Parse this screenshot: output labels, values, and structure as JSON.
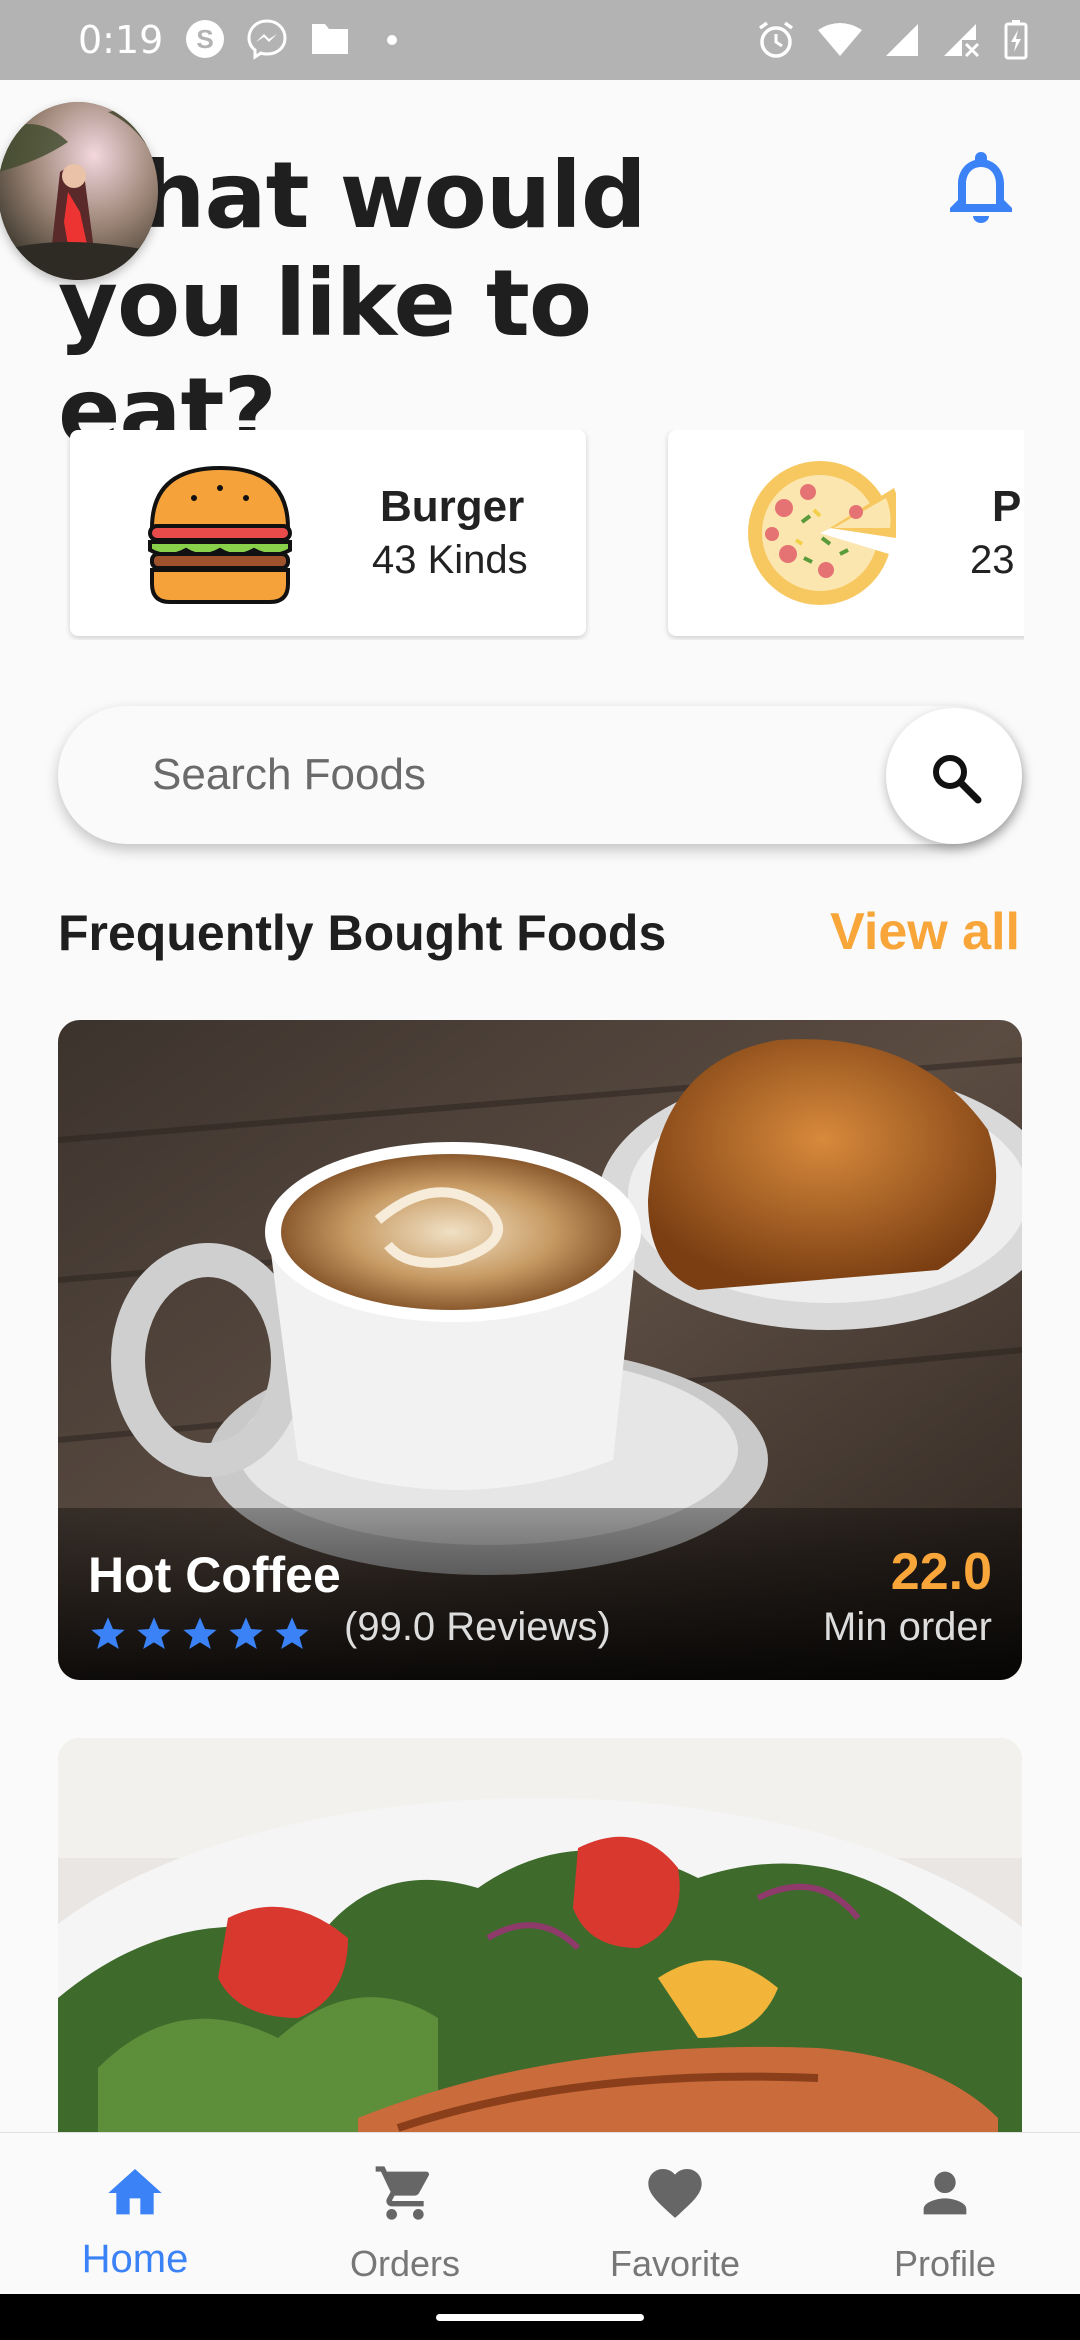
{
  "status_bar": {
    "time": "0:19",
    "left_icons": [
      "skype-icon",
      "messenger-icon",
      "folder-icon",
      "dot-icon"
    ],
    "right_icons": [
      "alarm-icon",
      "wifi-icon",
      "signal-icon",
      "signal-noservice-icon",
      "battery-charging-icon"
    ]
  },
  "header": {
    "title_line1": "hat would",
    "title_line2": "you like to eat?",
    "avatar_icon": "profile-avatar",
    "bell_icon": "bell-icon"
  },
  "categories": [
    {
      "name": "Burger",
      "count": "43 Kinds",
      "icon": "burger-icon"
    },
    {
      "name": "P",
      "count": "23",
      "icon": "pizza-icon"
    }
  ],
  "search": {
    "placeholder": "Search Foods",
    "icon": "search-icon"
  },
  "section": {
    "title": "Frequently Bought Foods",
    "view_all": "View all"
  },
  "foods": [
    {
      "name": "Hot Coffee",
      "rating": 5,
      "reviews": "(99.0 Reviews)",
      "price": "22.0",
      "min_order": "Min order"
    },
    {
      "name": "",
      "reviews": "",
      "price": "",
      "min_order": ""
    }
  ],
  "bottom_nav": [
    {
      "label": "Home",
      "icon": "home-icon",
      "active": true
    },
    {
      "label": "Orders",
      "icon": "cart-icon",
      "active": false
    },
    {
      "label": "Favorite",
      "icon": "heart-icon",
      "active": false
    },
    {
      "label": "Profile",
      "icon": "person-icon",
      "active": false
    }
  ],
  "colors": {
    "accent": "#f8a53a",
    "primary": "#3b82f6",
    "status_bar": "#b3b3b3"
  }
}
